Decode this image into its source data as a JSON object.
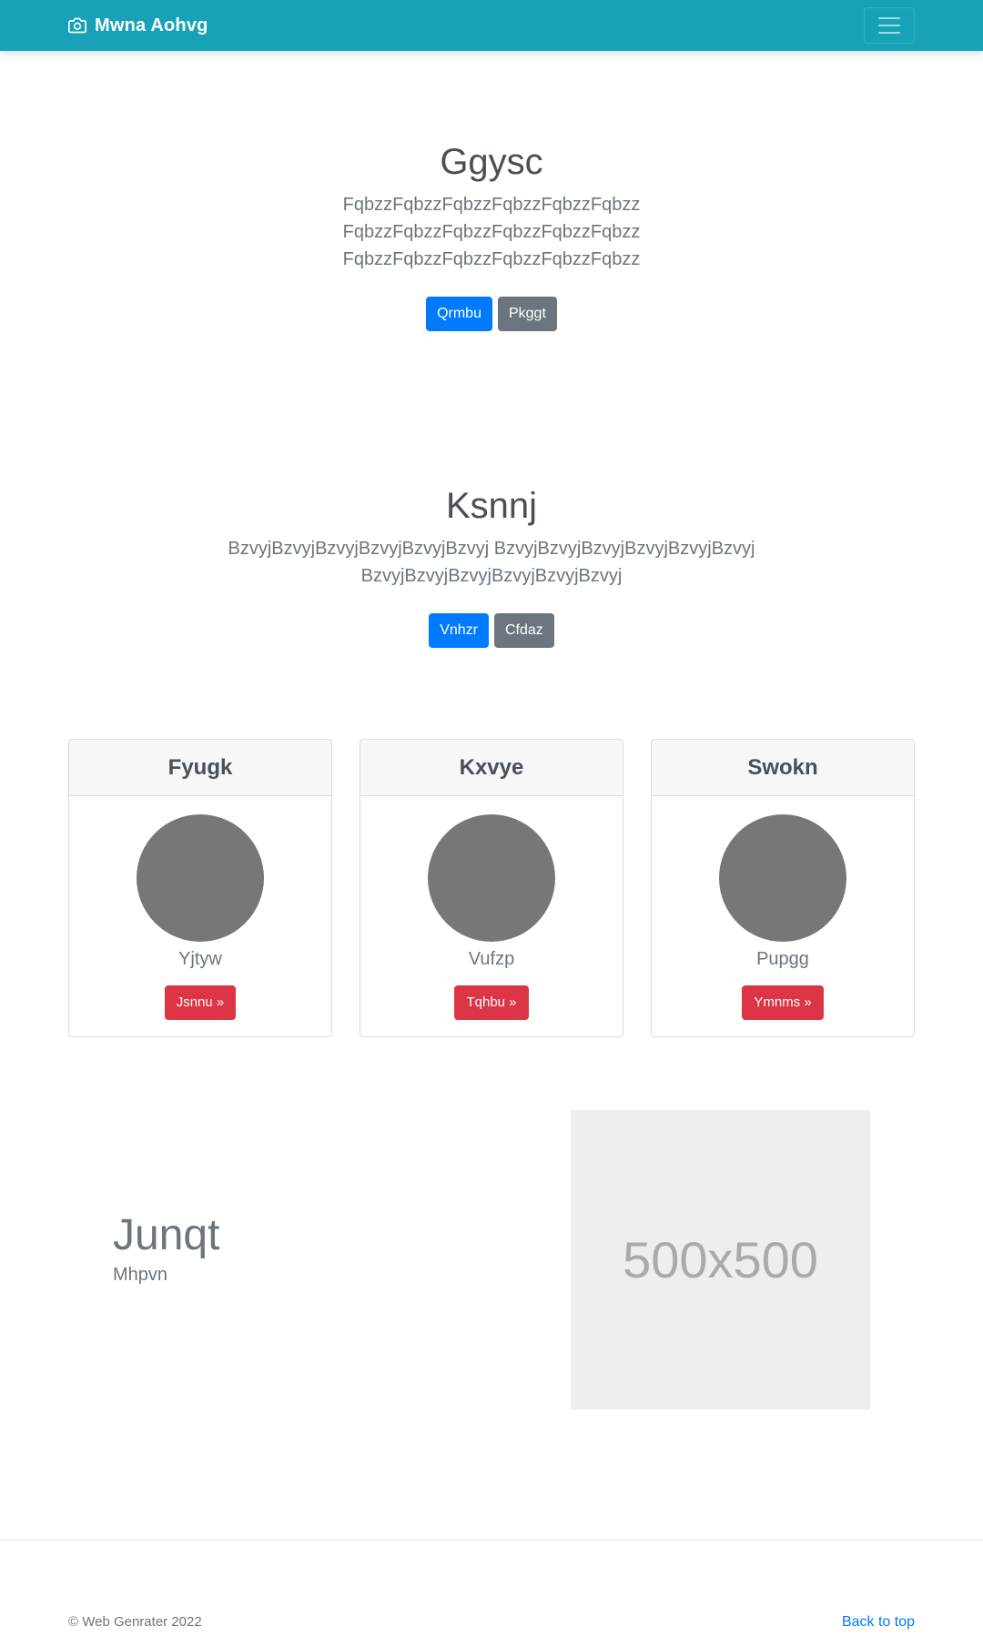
{
  "navbar": {
    "brand_icon": "camera-icon",
    "brand": "Mwna Aohvg",
    "toggler_icon": "hamburger-menu-icon",
    "background": "#17a2b8"
  },
  "hero1": {
    "title": "Ggysc",
    "text": "FqbzzFqbzzFqbzzFqbzzFqbzzFqbzz FqbzzFqbzzFqbzzFqbzzFqbzzFqbzz FqbzzFqbzzFqbzzFqbzzFqbzzFqbzz",
    "primary_label": "Qrmbu",
    "secondary_label": "Pkggt"
  },
  "hero2": {
    "title": "Ksnnj",
    "text": "BzvyjBzvyjBzvyjBzvyjBzvyjBzvyj BzvyjBzvyjBzvyjBzvyjBzvyjBzvyj BzvyjBzvyjBzvyjBzvyjBzvyjBzvyj",
    "primary_label": "Vnhzr",
    "secondary_label": "Cfdaz"
  },
  "cards": [
    {
      "header": "Fyugk",
      "name": "Yjtyw",
      "button": "Jsnnu »"
    },
    {
      "header": "Kxvye",
      "name": "Vufzp",
      "button": "Tqhbu »"
    },
    {
      "header": "Swokn",
      "name": "Pupgg",
      "button": "Ymnms »"
    }
  ],
  "feature": {
    "title": "Junqt",
    "subtitle": "Mhpvn",
    "image_label": "500x500"
  },
  "footer": {
    "copyright": "© Web Genrater 2022",
    "back_to_top": "Back to top"
  },
  "colors": {
    "primary": "#007bff",
    "secondary": "#6c757d",
    "danger": "#dc3545",
    "avatar": "#777777"
  }
}
